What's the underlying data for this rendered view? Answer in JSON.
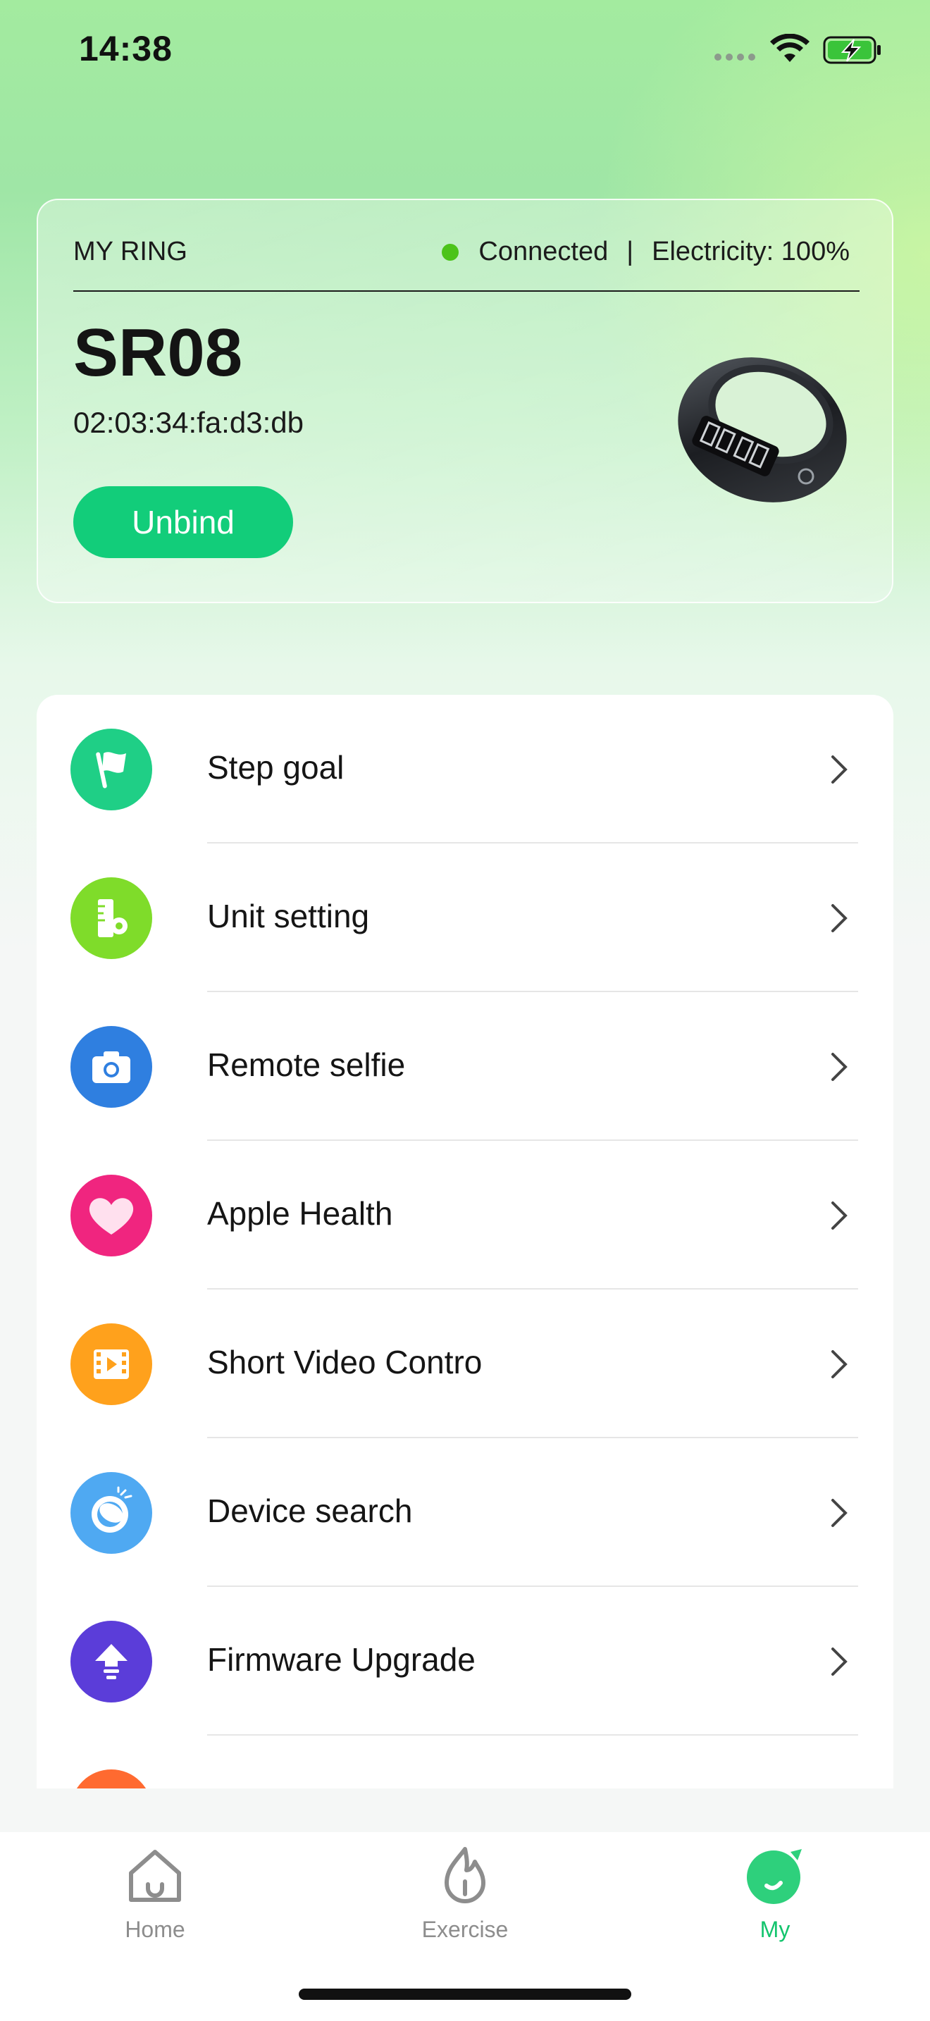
{
  "status_bar": {
    "time": "14:38",
    "icons": [
      "signal-icon",
      "wifi-icon",
      "battery-charging-icon"
    ]
  },
  "ring_card": {
    "title": "MY RING",
    "connection_status": "Connected",
    "separator": "|",
    "electricity": "Electricity: 100%",
    "device_name": "SR08",
    "mac_address": "02:03:34:fa:d3:db",
    "unbind_label": "Unbind",
    "status_color": "#4cc31a"
  },
  "settings": [
    {
      "label": "Step goal",
      "icon": "flag-icon",
      "color": "#1fcf86"
    },
    {
      "label": "Unit setting",
      "icon": "unit-gear-icon",
      "color": "#7fdc2a"
    },
    {
      "label": "Remote selfie",
      "icon": "camera-icon",
      "color": "#2f7fe0"
    },
    {
      "label": "Apple Health",
      "icon": "heart-icon",
      "color": "#f0257f"
    },
    {
      "label": "Short Video Contro",
      "icon": "video-icon",
      "color": "#ffa11c"
    },
    {
      "label": "Device search",
      "icon": "ring-search-icon",
      "color": "#4fa9f2"
    },
    {
      "label": "Firmware Upgrade",
      "icon": "upgrade-icon",
      "color": "#5b3dd9"
    }
  ],
  "tabs": [
    {
      "label": "Home",
      "icon": "home-icon",
      "active": false
    },
    {
      "label": "Exercise",
      "icon": "flame-icon",
      "active": false
    },
    {
      "label": "My",
      "icon": "my-icon",
      "active": true
    }
  ],
  "colors": {
    "accent": "#12cd7a",
    "active_tab": "#13c46d",
    "inactive_tab": "#8d8d8d"
  }
}
